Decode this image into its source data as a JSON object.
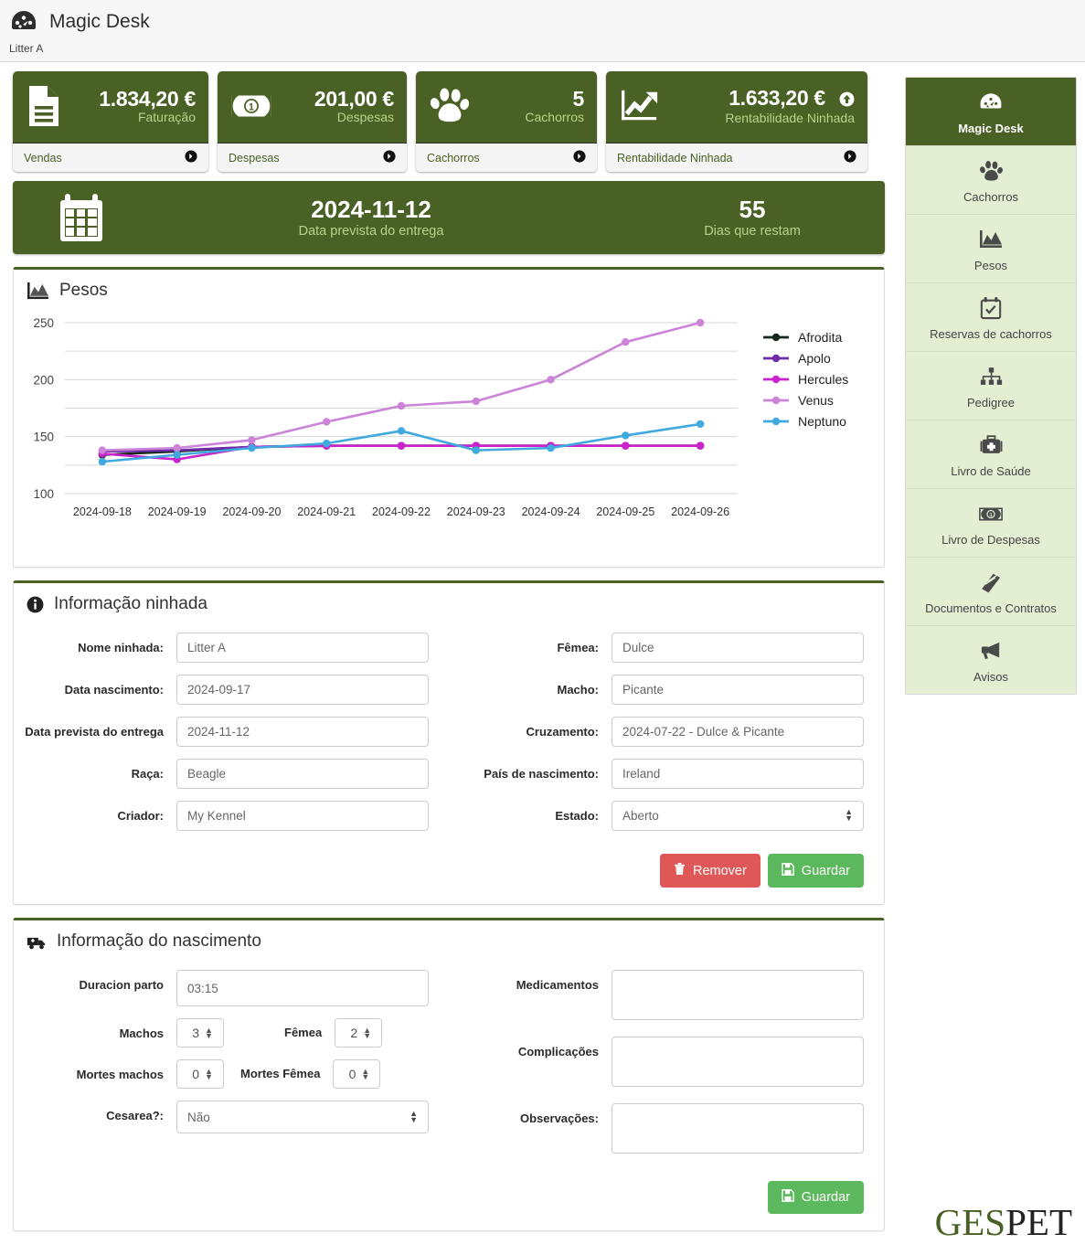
{
  "header": {
    "title": "Magic Desk",
    "breadcrumb": "Litter A",
    "logo_icon": "dashboard-icon"
  },
  "kpis": [
    {
      "value": "1.834,20 €",
      "label": "Faturação",
      "footer": "Vendas",
      "icon": "invoice-icon",
      "trend": false
    },
    {
      "value": "201,00 €",
      "label": "Despesas",
      "footer": "Despesas",
      "icon": "banknote-icon",
      "trend": false
    },
    {
      "value": "5",
      "label": "Cachorros",
      "footer": "Cachorros",
      "icon": "paw-icon",
      "trend": false
    },
    {
      "value": "1.633,20 €",
      "label": "Rentabilidade Ninhada",
      "footer": "Rentabilidade Ninhada",
      "icon": "chart-up-icon",
      "trend": true
    }
  ],
  "banner": {
    "icon": "calendar-icon",
    "date": "2024-11-12",
    "date_label": "Data prevista do entrega",
    "days": "55",
    "days_label": "Dias que restam"
  },
  "chart_panel": {
    "title": "Pesos",
    "icon": "area-chart-icon"
  },
  "chart_data": {
    "type": "line",
    "title": "Pesos",
    "xlabel": "",
    "ylabel": "",
    "ylim": [
      100,
      250
    ],
    "yticks": [
      100,
      150,
      200,
      250
    ],
    "grid": true,
    "legend_position": "right",
    "x": [
      "2024-09-18",
      "2024-09-19",
      "2024-09-20",
      "2024-09-21",
      "2024-09-22",
      "2024-09-23",
      "2024-09-24",
      "2024-09-25",
      "2024-09-26"
    ],
    "series": [
      {
        "name": "Afrodita",
        "color": "#15281c",
        "values": [
          134,
          137,
          141,
          142,
          142,
          142,
          142,
          142,
          142
        ]
      },
      {
        "name": "Apolo",
        "color": "#6f2da8",
        "values": [
          137,
          138,
          141,
          142,
          142,
          142,
          142,
          142,
          142
        ]
      },
      {
        "name": "Hercules",
        "color": "#cc22cc",
        "values": [
          135,
          130,
          141,
          142,
          142,
          142,
          142,
          142,
          142
        ]
      },
      {
        "name": "Venus",
        "color": "#cb84d8",
        "values": [
          138,
          140,
          147,
          163,
          177,
          181,
          200,
          233,
          250
        ]
      },
      {
        "name": "Neptuno",
        "color": "#3fa9e0",
        "values": [
          128,
          134,
          140,
          144,
          155,
          138,
          140,
          151,
          161
        ]
      }
    ]
  },
  "litter_panel": {
    "title": "Informação ninhada",
    "icon": "info-icon",
    "left_fields": [
      {
        "label": "Nome ninhada:",
        "value": "Litter A",
        "type": "text"
      },
      {
        "label": "Data nascimento:",
        "value": "2024-09-17",
        "type": "text"
      },
      {
        "label": "Data prevista do entrega",
        "value": "2024-11-12",
        "type": "text"
      },
      {
        "label": "Raça:",
        "value": "Beagle",
        "type": "text"
      },
      {
        "label": "Criador:",
        "value": "My Kennel",
        "type": "text"
      }
    ],
    "right_fields": [
      {
        "label": "Fêmea:",
        "value": "Dulce",
        "type": "text"
      },
      {
        "label": "Macho:",
        "value": "Picante",
        "type": "text"
      },
      {
        "label": "Cruzamento:",
        "value": "2024-07-22 - Dulce & Picante",
        "type": "text"
      },
      {
        "label": "País de nascimento:",
        "value": "Ireland",
        "type": "text"
      },
      {
        "label": "Estado:",
        "value": "Aberto",
        "type": "select"
      }
    ],
    "remove_label": "Remover",
    "save_label": "Guardar"
  },
  "birth_panel": {
    "title": "Informação do nascimento",
    "icon": "ambulance-icon",
    "duration_label": "Duracion parto",
    "duration_value": "03:15",
    "males_label": "Machos",
    "males_value": "3",
    "females_label": "Fêmea",
    "females_value": "2",
    "dead_males_label": "Mortes machos",
    "dead_males_value": "0",
    "dead_females_label": "Mortes Fêmea",
    "dead_females_value": "0",
    "cesarean_label": "Cesarea?:",
    "cesarean_value": "Não",
    "medication_label": "Medicamentos",
    "medication_value": "",
    "complications_label": "Complicações",
    "complications_value": "",
    "observations_label": "Observações:",
    "observations_value": "",
    "save_label": "Guardar"
  },
  "sidebar": {
    "items": [
      {
        "label": "Magic Desk",
        "icon": "dashboard-icon",
        "active": true
      },
      {
        "label": "Cachorros",
        "icon": "paw-icon",
        "active": false
      },
      {
        "label": "Pesos",
        "icon": "area-chart-icon",
        "active": false
      },
      {
        "label": "Reservas de cachorros",
        "icon": "calendar-check-icon",
        "active": false
      },
      {
        "label": "Pedigree",
        "icon": "sitemap-icon",
        "active": false
      },
      {
        "label": "Livro de Saúde",
        "icon": "medkit-icon",
        "active": false
      },
      {
        "label": "Livro de Despesas",
        "icon": "banknote-icon",
        "active": false
      },
      {
        "label": "Documentos e Contratos",
        "icon": "book-icon",
        "active": false
      },
      {
        "label": "Avisos",
        "icon": "megaphone-icon",
        "active": false
      }
    ]
  },
  "brand_footer": {
    "part1": "GES",
    "part2": "PET"
  },
  "colors": {
    "primary": "#4a6125",
    "accent_light": "#b9d38c",
    "sidebar_bg": "#e4eed2",
    "danger": "#df5757",
    "success": "#5cb85c"
  }
}
